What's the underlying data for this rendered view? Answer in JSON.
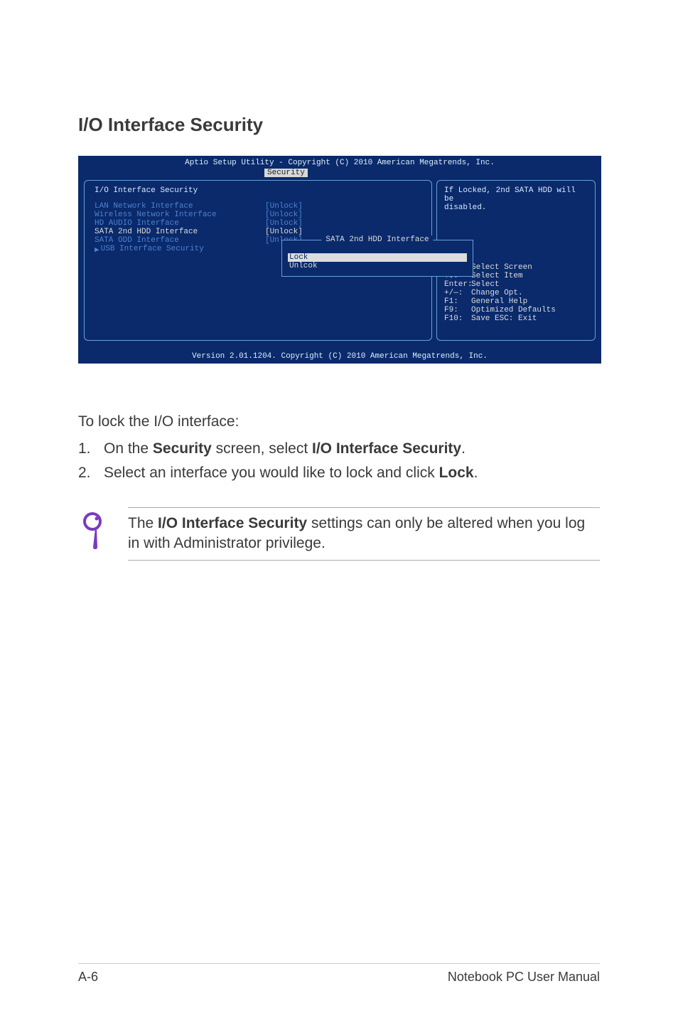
{
  "heading": "I/O Interface Security",
  "bios": {
    "top_line": "Aptio Setup Utility - Copyright (C) 2010 American Megatrends, Inc.",
    "active_tab": "Security",
    "left_title": "I/O Interface Security",
    "items": [
      {
        "label": "LAN Network Interface",
        "value": "[Unlock]"
      },
      {
        "label": "Wireless Network Interface",
        "value": "[Unlock]"
      },
      {
        "label": "HD AUDIO Interface",
        "value": "[Unlock]"
      },
      {
        "label": "SATA 2nd HDD Interface",
        "value": "[Unlock]",
        "selected": true
      },
      {
        "label": "SATA ODD Interface",
        "value": "[Unlock]"
      }
    ],
    "submenu": {
      "arrow": "▶",
      "label": "USB Interface Security"
    },
    "popup": {
      "title": "SATA 2nd HDD Interface",
      "options": [
        {
          "label": "Lock",
          "selected": true
        },
        {
          "label": "Unlcok",
          "selected": false
        }
      ]
    },
    "help_line1": "If Locked, 2nd SATA HDD will be",
    "help_line2": "disabled.",
    "keys": [
      {
        "glyph": "→←:",
        "text": "Select Screen"
      },
      {
        "glyph": "↑↓:",
        "text": "Select Item"
      },
      {
        "glyph": "Enter:",
        "text": "Select"
      },
      {
        "glyph": "+/—:",
        "text": "Change Opt."
      },
      {
        "glyph": "F1:",
        "text": "General Help"
      },
      {
        "glyph": "F9:",
        "text": "Optimized Defaults"
      },
      {
        "glyph": "F10:",
        "text": "Save   ESC: Exit"
      }
    ],
    "footer": "Version 2.01.1204. Copyright (C) 2010 American Megatrends, Inc."
  },
  "para_intro": "To lock the I/O interface:",
  "steps": [
    {
      "n": "1.",
      "before": "On the ",
      "b1": "Security",
      "mid": " screen, select ",
      "b2": "I/O Interface Security",
      "after": "."
    },
    {
      "n": "2.",
      "before": "Select an interface you would like to lock and click ",
      "b1": "Lock",
      "mid": "",
      "b2": "",
      "after": "."
    }
  ],
  "note": {
    "before": "The ",
    "bold": "I/O Interface Security",
    "after": " settings can only be altered when you log in with Administrator privilege."
  },
  "footer_left": "A-6",
  "footer_right": "Notebook PC User Manual"
}
